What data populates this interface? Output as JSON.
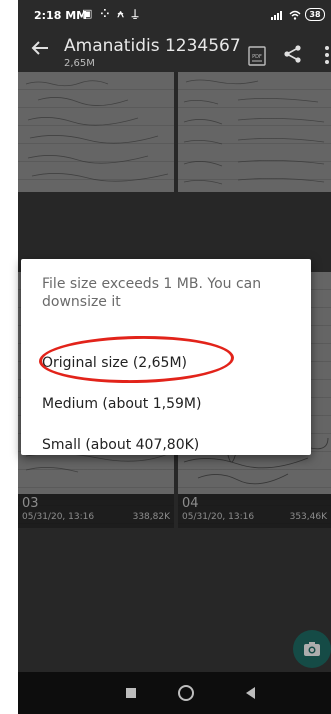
{
  "status_bar": {
    "time": "2:18 MM",
    "notification_icons": "▣ ⁘ ⍲ ⍊",
    "battery": "38"
  },
  "app_bar": {
    "title": "Amanatidis 1234567",
    "subtitle": "2,65M",
    "pdf_label": "PDF"
  },
  "pages": [
    {
      "number": "03",
      "date": "05/31/20, 13:16",
      "size": "338,82K"
    },
    {
      "number": "04",
      "date": "05/31/20, 13:16",
      "size": "353,46K"
    }
  ],
  "dialog": {
    "message": "File size exceeds 1 MB. You can downsize it",
    "options": [
      "Original size (2,65M)",
      "Medium (about 1,59M)",
      "Small (about 407,80K)"
    ]
  },
  "colors": {
    "annotation_circle": "#e2231a",
    "fab": "#1f6f68"
  }
}
